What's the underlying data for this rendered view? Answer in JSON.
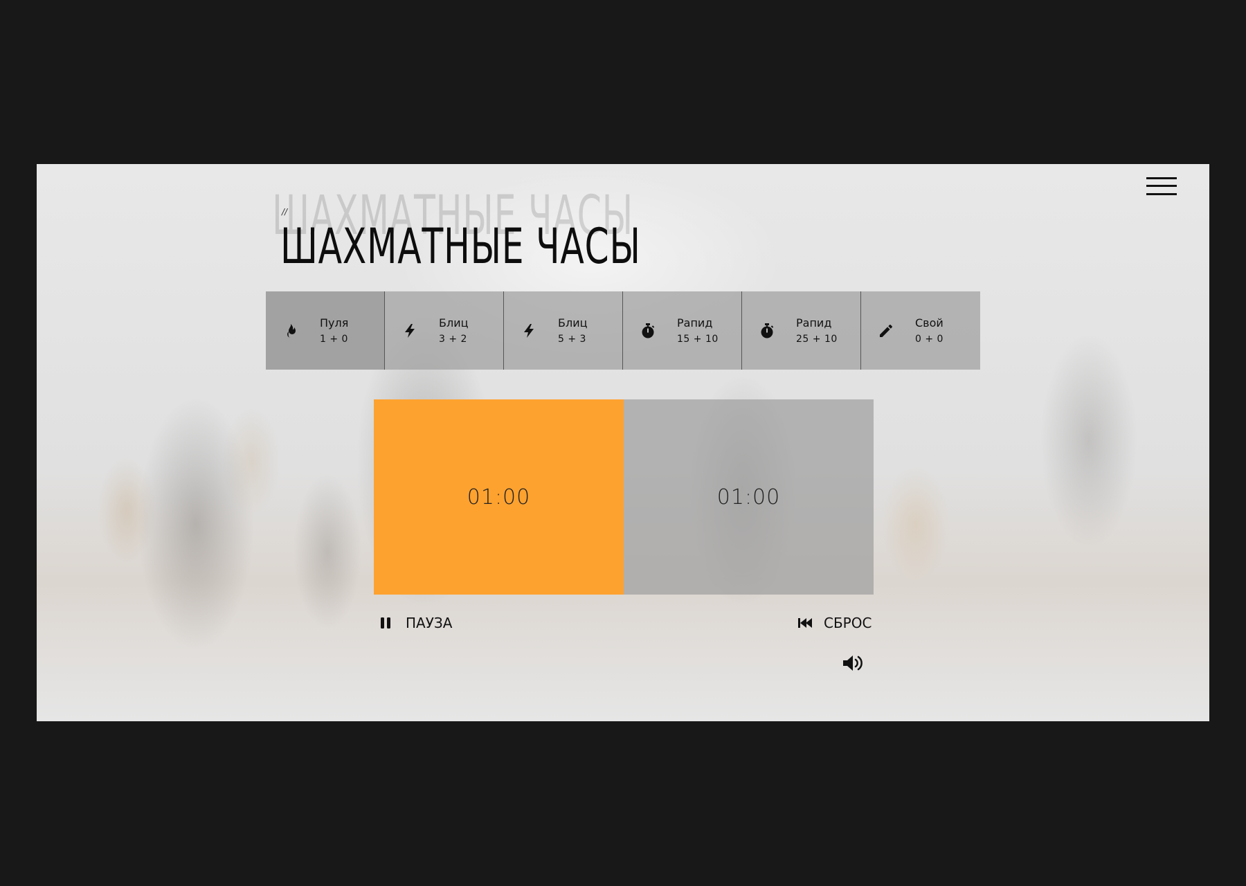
{
  "app": {
    "title": "ШАХМАТНЫЕ ЧАСЫ",
    "title_ghost": "ШАХМАТНЫЕ ЧАСЫ",
    "title_prefix": "//",
    "menu_icon": "hamburger-menu-icon"
  },
  "presets": [
    {
      "name": "Пуля",
      "time": "1 + 0",
      "icon": "fire-icon",
      "active": true
    },
    {
      "name": "Блиц",
      "time": "3 + 2",
      "icon": "lightning-icon",
      "active": false
    },
    {
      "name": "Блиц",
      "time": "5 + 3",
      "icon": "lightning-icon",
      "active": false
    },
    {
      "name": "Рапид",
      "time": "15 + 10",
      "icon": "stopwatch-icon",
      "active": false
    },
    {
      "name": "Рапид",
      "time": "25 + 10",
      "icon": "stopwatch-icon",
      "active": false
    },
    {
      "name": "Свой",
      "time": "0 + 0",
      "icon": "pencil-icon",
      "active": false
    }
  ],
  "clocks": {
    "left": {
      "time": "01:00",
      "active": true,
      "color": "#fea22f"
    },
    "right": {
      "time": "01:00",
      "active": false
    }
  },
  "controls": {
    "pause_label": "ПАУЗА",
    "pause_icon": "pause-icon",
    "reset_label": "СБРОС",
    "reset_icon": "rewind-icon",
    "volume_icon": "volume-icon"
  },
  "colors": {
    "accent": "#fea22f",
    "frame": "#181818"
  }
}
